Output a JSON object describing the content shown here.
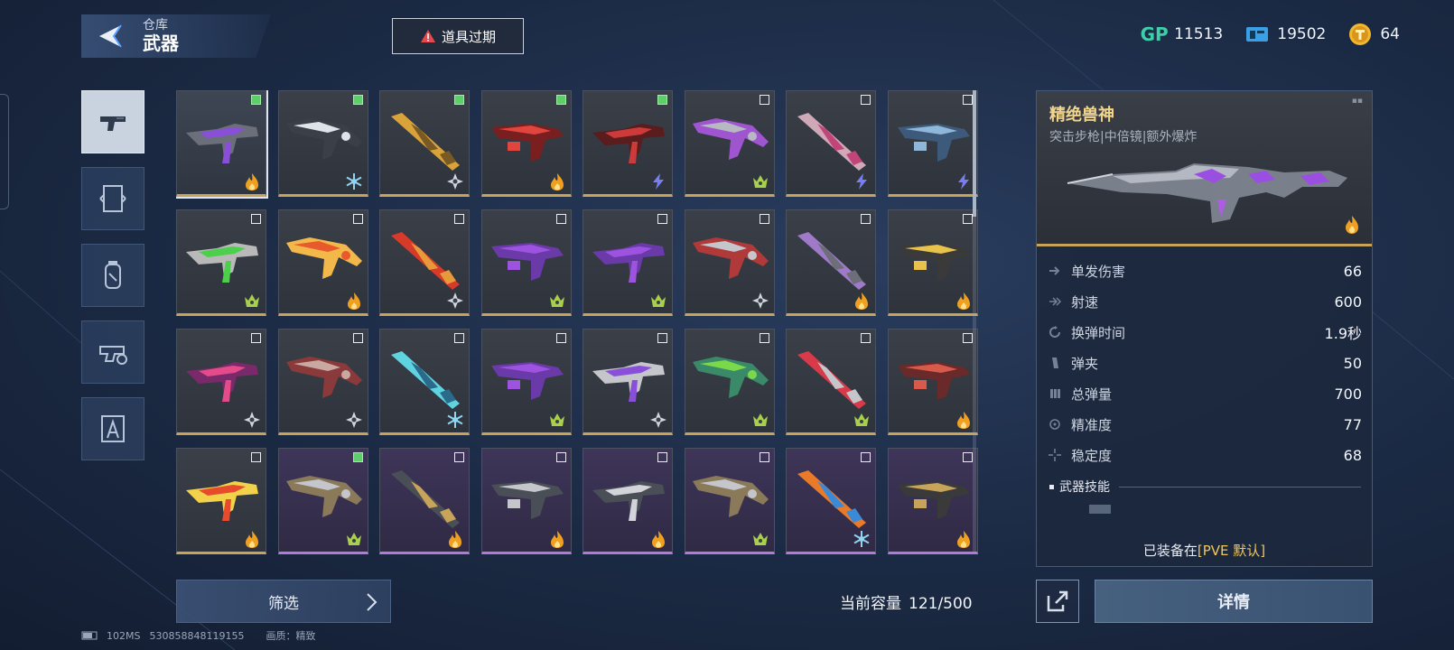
{
  "header": {
    "section_label": "仓库",
    "title": "武器",
    "expire_button": "道具过期"
  },
  "currencies": [
    {
      "icon": "gp-icon",
      "label": "GP",
      "value": "11513",
      "color": "#3ccfa8"
    },
    {
      "icon": "ticket-icon",
      "value": "19502",
      "color": "#3b9fe6"
    },
    {
      "icon": "gold-coin-icon",
      "value": "64",
      "color": "#f2b630"
    }
  ],
  "categories": [
    {
      "name": "pistol-category",
      "active": true
    },
    {
      "name": "scroll-category",
      "active": false
    },
    {
      "name": "grenade-category",
      "active": false
    },
    {
      "name": "gun-part-category",
      "active": false
    },
    {
      "name": "tool-category",
      "active": false
    }
  ],
  "weapons": [
    {
      "name": "weapon-1",
      "palette": [
        "#8a4fd8",
        "#6b6f7a"
      ],
      "checked": true,
      "badge": "fire",
      "rarity": "gold",
      "selected": true
    },
    {
      "name": "weapon-2",
      "palette": [
        "#dfe3ea",
        "#3b3f47"
      ],
      "checked": true,
      "badge": "snow",
      "rarity": "gold"
    },
    {
      "name": "weapon-3",
      "palette": [
        "#d9a33a",
        "#7a5a24"
      ],
      "checked": true,
      "badge": "star",
      "rarity": "gold"
    },
    {
      "name": "weapon-4",
      "palette": [
        "#e0463e",
        "#7a1f1f"
      ],
      "checked": true,
      "badge": "fire",
      "rarity": "gold"
    },
    {
      "name": "weapon-5",
      "palette": [
        "#cc3a3a",
        "#5a1c1c"
      ],
      "checked": true,
      "badge": "bolt",
      "rarity": "gold"
    },
    {
      "name": "weapon-6",
      "palette": [
        "#b7b9c2",
        "#a055d0"
      ],
      "checked": false,
      "badge": "crown",
      "rarity": "gold"
    },
    {
      "name": "weapon-7",
      "palette": [
        "#cfa9b8",
        "#c2457a"
      ],
      "checked": false,
      "badge": "bolt",
      "rarity": "gold"
    },
    {
      "name": "weapon-8",
      "palette": [
        "#8fb7d9",
        "#3e5a7a"
      ],
      "checked": false,
      "badge": "bolt",
      "rarity": "gold"
    },
    {
      "name": "weapon-9",
      "palette": [
        "#4cd04c",
        "#b9b9b9"
      ],
      "checked": false,
      "badge": "crown",
      "rarity": "gold"
    },
    {
      "name": "weapon-10",
      "palette": [
        "#e85a2c",
        "#f2b84a"
      ],
      "checked": false,
      "badge": "fire",
      "rarity": "gold"
    },
    {
      "name": "weapon-11",
      "palette": [
        "#d83a2a",
        "#e89a3a"
      ],
      "checked": false,
      "badge": "star",
      "rarity": "gold"
    },
    {
      "name": "weapon-12",
      "palette": [
        "#9e52e0",
        "#6a3aa8"
      ],
      "checked": false,
      "badge": "crown",
      "rarity": "gold"
    },
    {
      "name": "weapon-13",
      "palette": [
        "#9e52e0",
        "#6a3aa8"
      ],
      "checked": false,
      "badge": "crown",
      "rarity": "gold"
    },
    {
      "name": "weapon-14",
      "palette": [
        "#c4c6cc",
        "#b03a3a"
      ],
      "checked": false,
      "badge": "star",
      "rarity": "gold"
    },
    {
      "name": "weapon-15",
      "palette": [
        "#9e7ac8",
        "#6e6e7a"
      ],
      "checked": false,
      "badge": "fire",
      "rarity": "gold"
    },
    {
      "name": "weapon-16",
      "palette": [
        "#e8c24a",
        "#3a3a3a"
      ],
      "checked": false,
      "badge": "fire",
      "rarity": "gold"
    },
    {
      "name": "weapon-17",
      "palette": [
        "#e54a8a",
        "#7a2a6a"
      ],
      "checked": false,
      "badge": "star",
      "rarity": "gold"
    },
    {
      "name": "weapon-18",
      "palette": [
        "#c8a8a0",
        "#8a3a3a"
      ],
      "checked": false,
      "badge": "star",
      "rarity": "gold"
    },
    {
      "name": "weapon-19",
      "palette": [
        "#5fd3e0",
        "#2a6a8a"
      ],
      "checked": false,
      "badge": "snow",
      "rarity": "gold"
    },
    {
      "name": "weapon-20",
      "palette": [
        "#9e52e0",
        "#6a3aa8"
      ],
      "checked": false,
      "badge": "crown",
      "rarity": "gold"
    },
    {
      "name": "weapon-21",
      "palette": [
        "#8a4fd8",
        "#c4c6cc"
      ],
      "checked": false,
      "badge": "star",
      "rarity": "gold"
    },
    {
      "name": "weapon-22",
      "palette": [
        "#7ad84a",
        "#3a8a6a"
      ],
      "checked": false,
      "badge": "crown",
      "rarity": "gold"
    },
    {
      "name": "weapon-23",
      "palette": [
        "#d83a4a",
        "#c4c6cc"
      ],
      "checked": false,
      "badge": "crown",
      "rarity": "gold"
    },
    {
      "name": "weapon-24",
      "palette": [
        "#d85a4a",
        "#6a2a2a"
      ],
      "checked": false,
      "badge": "fire",
      "rarity": "gold"
    },
    {
      "name": "weapon-25",
      "palette": [
        "#e84a2c",
        "#f2d24a"
      ],
      "checked": false,
      "badge": "fire",
      "rarity": "gold"
    },
    {
      "name": "weapon-26",
      "palette": [
        "#c4c6cc",
        "#8a7a5a"
      ],
      "checked": true,
      "badge": "crown",
      "rarity": "purple"
    },
    {
      "name": "weapon-27",
      "palette": [
        "#4a4e56",
        "#c8a45a"
      ],
      "checked": false,
      "badge": "fire",
      "rarity": "purple"
    },
    {
      "name": "weapon-28",
      "palette": [
        "#c4c6cc",
        "#4a4e56"
      ],
      "checked": false,
      "badge": "fire",
      "rarity": "purple"
    },
    {
      "name": "weapon-29",
      "palette": [
        "#d2d4da",
        "#4a4e56"
      ],
      "checked": false,
      "badge": "fire",
      "rarity": "purple"
    },
    {
      "name": "weapon-30",
      "palette": [
        "#c4c6cc",
        "#8a7a5a"
      ],
      "checked": false,
      "badge": "crown",
      "rarity": "purple"
    },
    {
      "name": "weapon-31",
      "palette": [
        "#e87a2a",
        "#3a8ad8"
      ],
      "checked": false,
      "badge": "snow",
      "rarity": "purple"
    },
    {
      "name": "weapon-32",
      "palette": [
        "#c8a45a",
        "#3a3a3a"
      ],
      "checked": false,
      "badge": "fire",
      "rarity": "purple"
    }
  ],
  "filter": {
    "label": "筛选"
  },
  "capacity": {
    "label": "当前容量",
    "value": "121/500"
  },
  "status": {
    "ping": "102MS",
    "uid": "530858848119155",
    "quality": "画质：精致"
  },
  "detail": {
    "name": "精绝兽神",
    "tags": "突击步枪|中倍镜|额外爆炸",
    "stats": [
      {
        "icon": "damage-icon",
        "label": "单发伤害",
        "value": "66"
      },
      {
        "icon": "fire-rate-icon",
        "label": "射速",
        "value": "600"
      },
      {
        "icon": "reload-icon",
        "label": "换弹时间",
        "value": "1.9秒"
      },
      {
        "icon": "magazine-icon",
        "label": "弹夹",
        "value": "50"
      },
      {
        "icon": "ammo-icon",
        "label": "总弹量",
        "value": "700"
      },
      {
        "icon": "accuracy-icon",
        "label": "精准度",
        "value": "77"
      },
      {
        "icon": "stability-icon",
        "label": "稳定度",
        "value": "68"
      }
    ],
    "skills_label": "武器技能",
    "equipped_prefix": "已装备在",
    "equipped_slot": "[PVE 默认]"
  },
  "buttons": {
    "details": "详情"
  }
}
